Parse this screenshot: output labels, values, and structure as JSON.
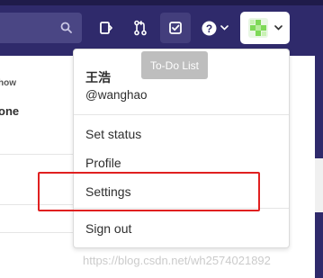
{
  "navbar": {
    "icons": [
      "search-icon",
      "issues-icon",
      "merge-requests-icon",
      "todo-check-icon",
      "help-icon",
      "chevron-down-icon"
    ],
    "colors": {
      "bar": "#2f2a6b",
      "search": "#4a4684",
      "active": "#433e7c"
    }
  },
  "tooltip": {
    "text": "To-Do List"
  },
  "page": {
    "label_fragment": "how",
    "value_fragment": "one"
  },
  "user_menu": {
    "name": "王浩",
    "username": "@wanghao",
    "items": [
      {
        "label": "Set status"
      },
      {
        "label": "Profile"
      },
      {
        "label": "Settings",
        "highlighted": true
      },
      {
        "label": "Sign out"
      }
    ],
    "highlight_color": "#e02020"
  },
  "watermark": "https://blog.csdn.net/wh2574021892"
}
